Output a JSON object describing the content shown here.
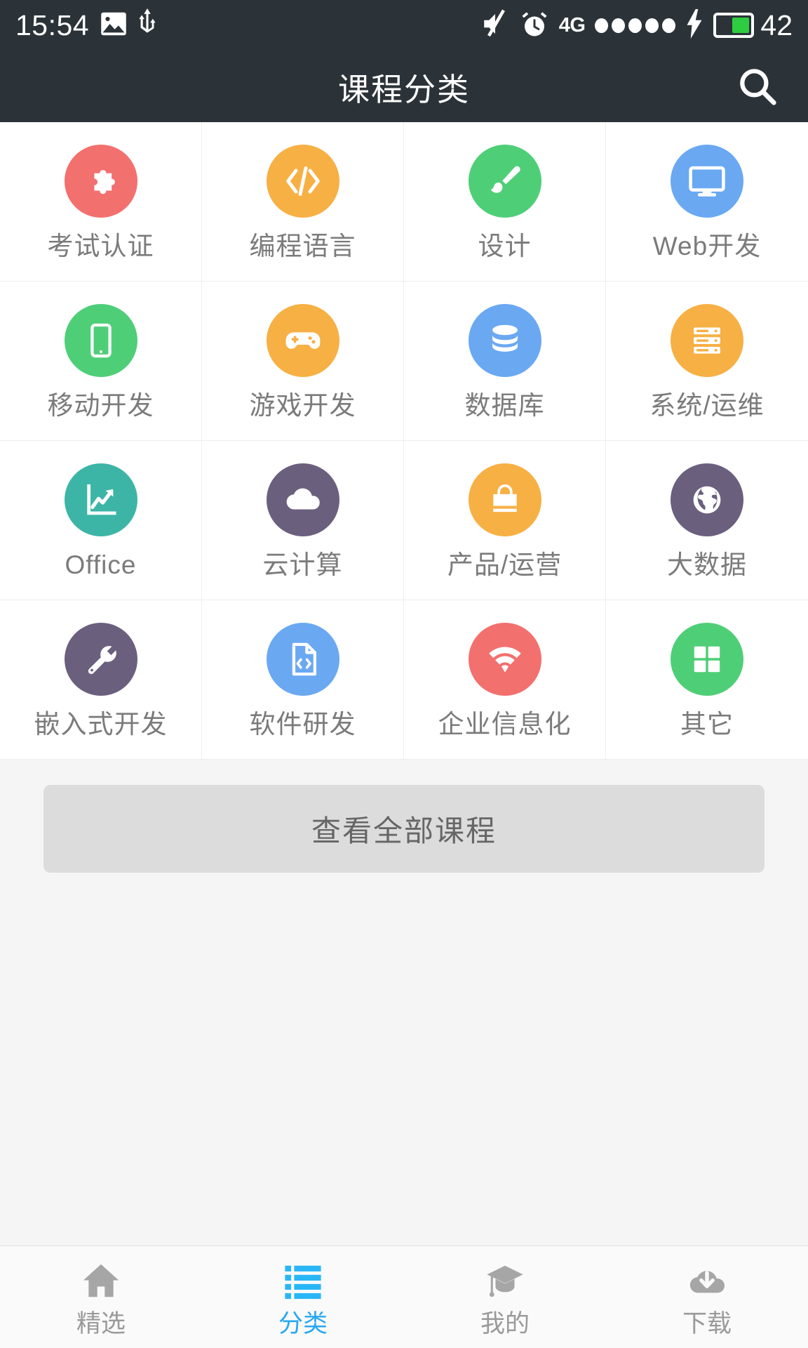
{
  "statusbar": {
    "time": "15:54",
    "image_icon": "image-icon",
    "usb_icon": "usb-icon",
    "mute_icon": "mute-icon",
    "alarm_icon": "alarm-icon",
    "network": "4G",
    "signal_dots": 5,
    "charging_icon": "charging-bolt-icon",
    "battery_level": "42"
  },
  "header": {
    "title": "课程分类",
    "search_icon": "search-icon"
  },
  "categories": [
    {
      "label": "考试认证",
      "icon": "puzzle-icon",
      "color": "#f2706e"
    },
    {
      "label": "编程语言",
      "icon": "code-brackets-icon",
      "color": "#f7b044"
    },
    {
      "label": "设计",
      "icon": "paintbrush-icon",
      "color": "#4fce78"
    },
    {
      "label": "Web开发",
      "icon": "monitor-icon",
      "color": "#6aa8f2"
    },
    {
      "label": "移动开发",
      "icon": "smartphone-icon",
      "color": "#4fce78"
    },
    {
      "label": "游戏开发",
      "icon": "gamepad-icon",
      "color": "#f7b044"
    },
    {
      "label": "数据库",
      "icon": "database-icon",
      "color": "#6aa8f2"
    },
    {
      "label": "系统/运维",
      "icon": "server-icon",
      "color": "#f7b044"
    },
    {
      "label": "Office",
      "icon": "chart-growth-icon",
      "color": "#3cb5a6"
    },
    {
      "label": "云计算",
      "icon": "cloud-icon",
      "color": "#6b5f7e"
    },
    {
      "label": "产品/运营",
      "icon": "shopping-bag-icon",
      "color": "#f7b044"
    },
    {
      "label": "大数据",
      "icon": "globe-icon",
      "color": "#6b5f7e"
    },
    {
      "label": "嵌入式开发",
      "icon": "wrench-icon",
      "color": "#6b5f7e"
    },
    {
      "label": "软件研发",
      "icon": "code-file-icon",
      "color": "#6aa8f2"
    },
    {
      "label": "企业信息化",
      "icon": "wifi-icon",
      "color": "#f2706e"
    },
    {
      "label": "其它",
      "icon": "grid-squares-icon",
      "color": "#4fce78"
    }
  ],
  "all_courses": {
    "label": "查看全部课程"
  },
  "tabbar": {
    "active_color": "#28a8f0",
    "inactive_color": "#9a9a9a",
    "items": [
      {
        "label": "精选",
        "icon": "home-icon",
        "active": false
      },
      {
        "label": "分类",
        "icon": "list-icon",
        "active": true
      },
      {
        "label": "我的",
        "icon": "graduation-cap-icon",
        "active": false
      },
      {
        "label": "下载",
        "icon": "download-cloud-icon",
        "active": false
      }
    ]
  }
}
